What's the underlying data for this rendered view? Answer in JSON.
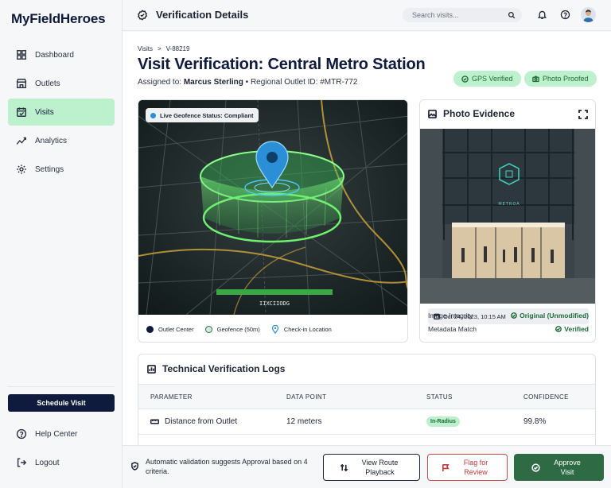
{
  "app": {
    "brand": "MyFieldHeroes"
  },
  "sidebar": {
    "items": [
      {
        "label": "Dashboard",
        "icon": "grid-icon"
      },
      {
        "label": "Outlets",
        "icon": "storefront-icon"
      },
      {
        "label": "Visits",
        "icon": "calendar-check-icon",
        "active": true
      },
      {
        "label": "Analytics",
        "icon": "chart-line-icon"
      },
      {
        "label": "Settings",
        "icon": "gear-icon"
      }
    ],
    "schedule_label": "Schedule Visit",
    "help_label": "Help Center",
    "logout_label": "Logout"
  },
  "header": {
    "title": "Verification Details",
    "search_placeholder": "Search visits..."
  },
  "breadcrumb": {
    "parent": "Visits",
    "separator": ">",
    "current": "V-88219"
  },
  "page": {
    "title": "Visit Verification: Central Metro Station",
    "assigned_prefix": "Assigned to:",
    "assignee": "Marcus Sterling",
    "bullet": "•",
    "outlet_id": "Regional Outlet ID: #MTR-772",
    "badges": {
      "gps": "GPS Verified",
      "photo": "Photo Proofed"
    }
  },
  "map": {
    "status": "Live Geofence Status: Compliant",
    "legend": {
      "outlet": "Outlet Center",
      "geofence": "Geofence (50m)",
      "checkin": "Check-in Location"
    }
  },
  "photo": {
    "title": "Photo Evidence",
    "timestamp": "Oct 24, 2023, 10:15 AM",
    "integrity_label": "Image Integrity",
    "integrity_value": "Original (Unmodified)",
    "metadata_label": "Metadata Match",
    "metadata_value": "Verified"
  },
  "logs": {
    "title": "Technical Verification Logs",
    "columns": [
      "PARAMETER",
      "DATA POINT",
      "STATUS",
      "CONFIDENCE"
    ],
    "rows": [
      {
        "parameter": "Distance from Outlet",
        "data_point": "12 meters",
        "status": "In-Radius",
        "confidence": "99.8%"
      }
    ]
  },
  "footer": {
    "message": "Automatic validation suggests Approval based on 4 criteria.",
    "route_label": "View Route Playback",
    "flag_label": "Flag for Review",
    "approve_label": "Approve Visit"
  },
  "colors": {
    "brand_navy": "#0f1b3d",
    "accent_green": "#bdf0cc",
    "approve_green": "#2e6b45",
    "flag_red": "#c23a3a",
    "geofence_green": "#5fe06a",
    "pin_blue": "#2a8fd6"
  }
}
